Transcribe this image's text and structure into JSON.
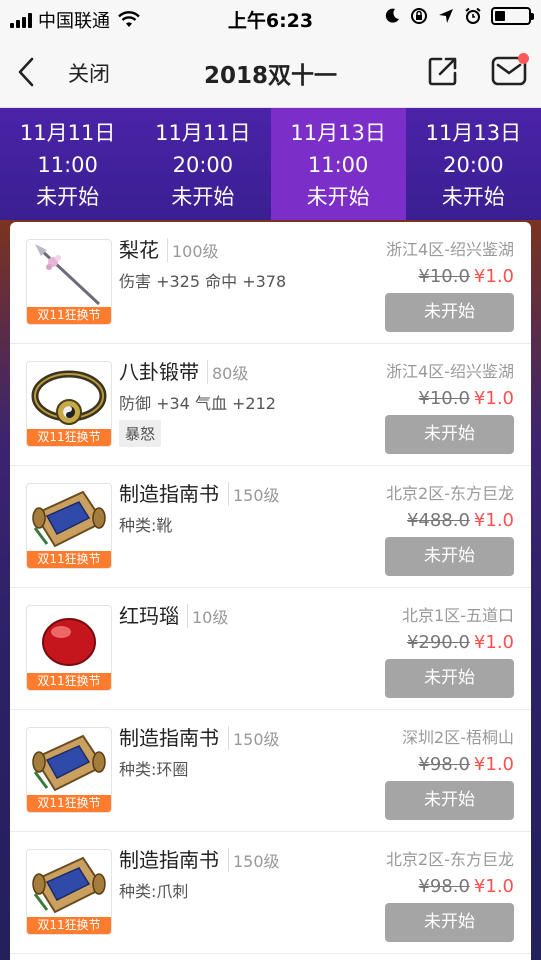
{
  "status_bar": {
    "carrier": "中国联通",
    "time": "上午6:23",
    "icons": [
      "signal-icon",
      "wifi-icon",
      "moon-icon",
      "rotation-lock-icon",
      "location-icon",
      "alarm-icon",
      "battery-icon"
    ]
  },
  "nav": {
    "back_icon": "chevron-left-icon",
    "close_label": "关闭",
    "title": "2018双十一",
    "share_icon": "share-icon",
    "mail_icon": "mail-icon"
  },
  "date_tabs": [
    {
      "date": "11月11日",
      "time": "11:00",
      "status": "未开始",
      "active": false
    },
    {
      "date": "11月11日",
      "time": "20:00",
      "status": "未开始",
      "active": false
    },
    {
      "date": "11月13日",
      "time": "11:00",
      "status": "未开始",
      "active": true
    },
    {
      "date": "11月13日",
      "time": "20:00",
      "status": "未开始",
      "active": false
    }
  ],
  "items": [
    {
      "name": "梨花",
      "level": "100级",
      "stats": "伤害 +325 命中 +378",
      "tag": "",
      "server": "浙江4区-绍兴鉴湖",
      "old_price": "¥10.0",
      "new_price": "¥1.0",
      "button": "未开始",
      "badge": "双11狂换节",
      "icon": "spear-icon"
    },
    {
      "name": "八卦锻带",
      "level": "80级",
      "stats": "防御 +34 气血 +212",
      "tag": "暴怒",
      "server": "浙江4区-绍兴鉴湖",
      "old_price": "¥10.0",
      "new_price": "¥1.0",
      "button": "未开始",
      "badge": "双11狂换节",
      "icon": "bagua-belt-icon"
    },
    {
      "name": "制造指南书",
      "level": "150级",
      "stats": "种类:靴",
      "tag": "",
      "server": "北京2区-东方巨龙",
      "old_price": "¥488.0",
      "new_price": "¥1.0",
      "button": "未开始",
      "badge": "双11狂换节",
      "icon": "scroll-icon"
    },
    {
      "name": "红玛瑙",
      "level": "10级",
      "stats": "",
      "tag": "",
      "server": "北京1区-五道口",
      "old_price": "¥290.0",
      "new_price": "¥1.0",
      "button": "未开始",
      "badge": "双11狂换节",
      "icon": "red-agate-icon"
    },
    {
      "name": "制造指南书",
      "level": "150级",
      "stats": "种类:环圈",
      "tag": "",
      "server": "深圳2区-梧桐山",
      "old_price": "¥98.0",
      "new_price": "¥1.0",
      "button": "未开始",
      "badge": "双11狂换节",
      "icon": "scroll-icon"
    },
    {
      "name": "制造指南书",
      "level": "150级",
      "stats": "种类:爪刺",
      "tag": "",
      "server": "北京2区-东方巨龙",
      "old_price": "¥98.0",
      "new_price": "¥1.0",
      "button": "未开始",
      "badge": "双11狂换节",
      "icon": "scroll-icon"
    }
  ],
  "colors": {
    "tab_bg": "#3a1f92",
    "tab_active": "#7b2ec8",
    "badge": "#ff7b2e",
    "price_new": "#ff5050",
    "button_disabled": "#a5a5a5"
  }
}
